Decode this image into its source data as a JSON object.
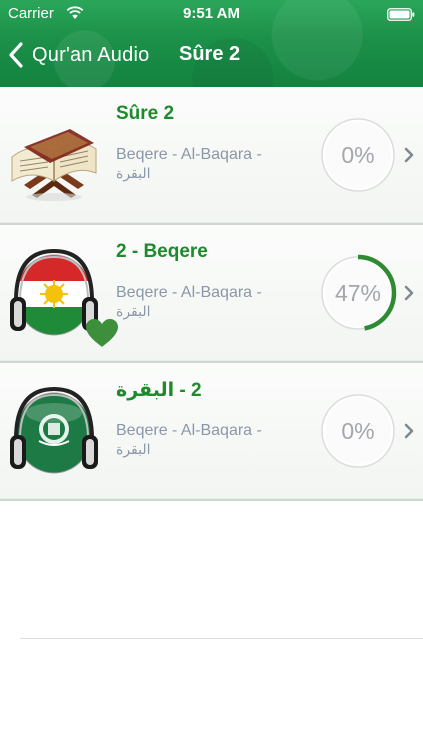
{
  "status_bar": {
    "carrier": "Carrier",
    "time": "9:51 AM"
  },
  "nav": {
    "back_label": "Qur'an Audio",
    "title": "Sûre 2"
  },
  "colors": {
    "nav_green": "#1c9048",
    "title_green": "#1e8a2c",
    "progress_green": "#2e8b32",
    "subtitle_gray": "#8b97a8"
  },
  "rows": [
    {
      "title": "Sûre 2",
      "subtitle": "Beqere - Al-Baqara -",
      "subtitle_ar": "البقرة",
      "progress_percent": 0,
      "progress_label": "0%",
      "icon": "quran-book-icon",
      "favorite": false
    },
    {
      "title": "2 - Beqere",
      "subtitle": "Beqere - Al-Baqara -",
      "subtitle_ar": "البقرة",
      "progress_percent": 47,
      "progress_label": "47%",
      "icon": "headphones-kurdistan-flag-icon",
      "favorite": true
    },
    {
      "title": "2 - البقرة",
      "subtitle": "Beqere - Al-Baqara -",
      "subtitle_ar": "البقرة",
      "progress_percent": 0,
      "progress_label": "0%",
      "icon": "headphones-arab-league-flag-icon",
      "favorite": false
    }
  ]
}
